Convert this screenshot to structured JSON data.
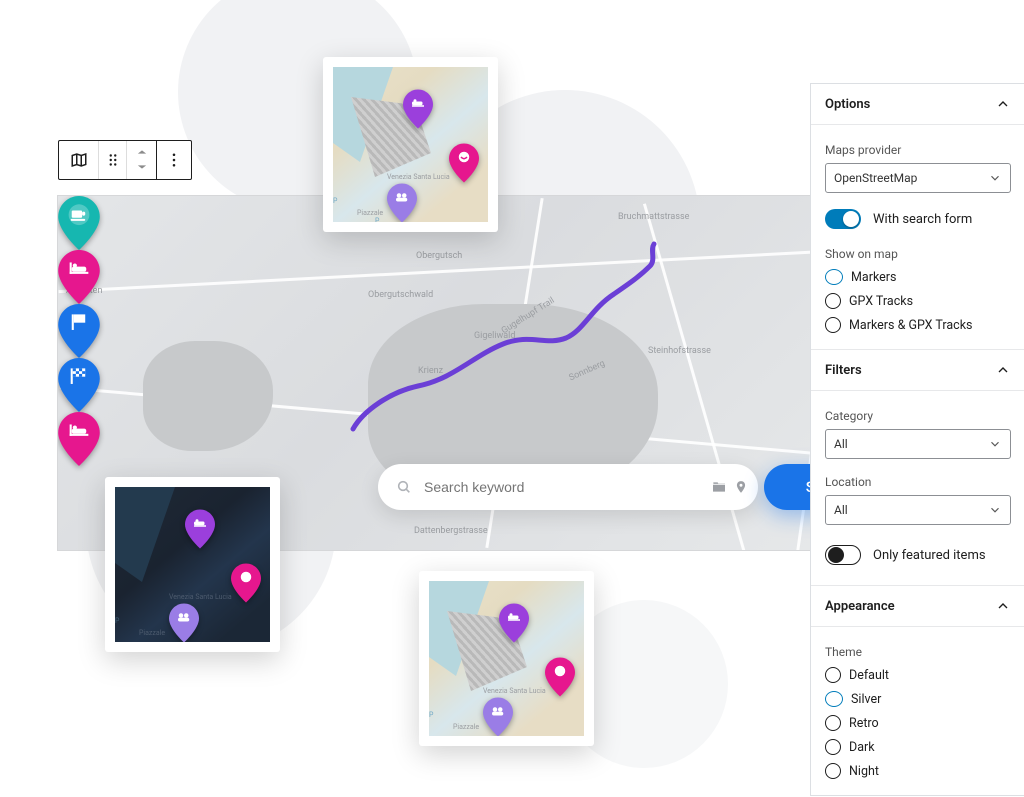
{
  "toolbar": {
    "block_icon": "map-block-icon",
    "drag_icon": "drag-handle-icon",
    "mover_up": "mover-up-icon",
    "mover_down": "mover-down-icon",
    "more_icon": "more-options-icon"
  },
  "search": {
    "placeholder": "Search keyword",
    "value": "",
    "button_label": "Search"
  },
  "sidebar": {
    "options": {
      "title": "Options",
      "provider_label": "Maps provider",
      "provider_selected": "OpenStreetMap",
      "search_form_label": "With search form",
      "search_form_on": true,
      "show_on_map_label": "Show on map",
      "show_on_map": [
        "Markers",
        "GPX Tracks",
        "Markers & GPX Tracks"
      ],
      "show_on_map_selected": 0
    },
    "filters": {
      "title": "Filters",
      "category_label": "Category",
      "category_selected": "All",
      "location_label": "Location",
      "location_selected": "All",
      "featured_label": "Only featured items",
      "featured_on": false
    },
    "appearance": {
      "title": "Appearance",
      "theme_label": "Theme",
      "themes": [
        "Default",
        "Silver",
        "Retro",
        "Dark",
        "Night"
      ],
      "theme_selected": 1
    }
  },
  "colors": {
    "teal": "#16b7b0",
    "magenta": "#e6178e",
    "blue": "#1a74e8",
    "purple": "#9b3fdc",
    "violet": "#9a7de6",
    "route": "#6b3fd6"
  },
  "map_labels": {
    "a": "Aegerten",
    "b": "Obergutsch",
    "c": "Obergutschwald",
    "d": "Krienz",
    "e": "Gigeliwald",
    "f": "Steinhofstrasse",
    "g": "Dattenbergstrasse",
    "h": "Bruchmattstrasse",
    "i": "Gugelhupf Trail",
    "j": "Sonnberg"
  },
  "thumb_labels": {
    "a": "Venezia Santa Lucia",
    "b": "Piazzale"
  }
}
